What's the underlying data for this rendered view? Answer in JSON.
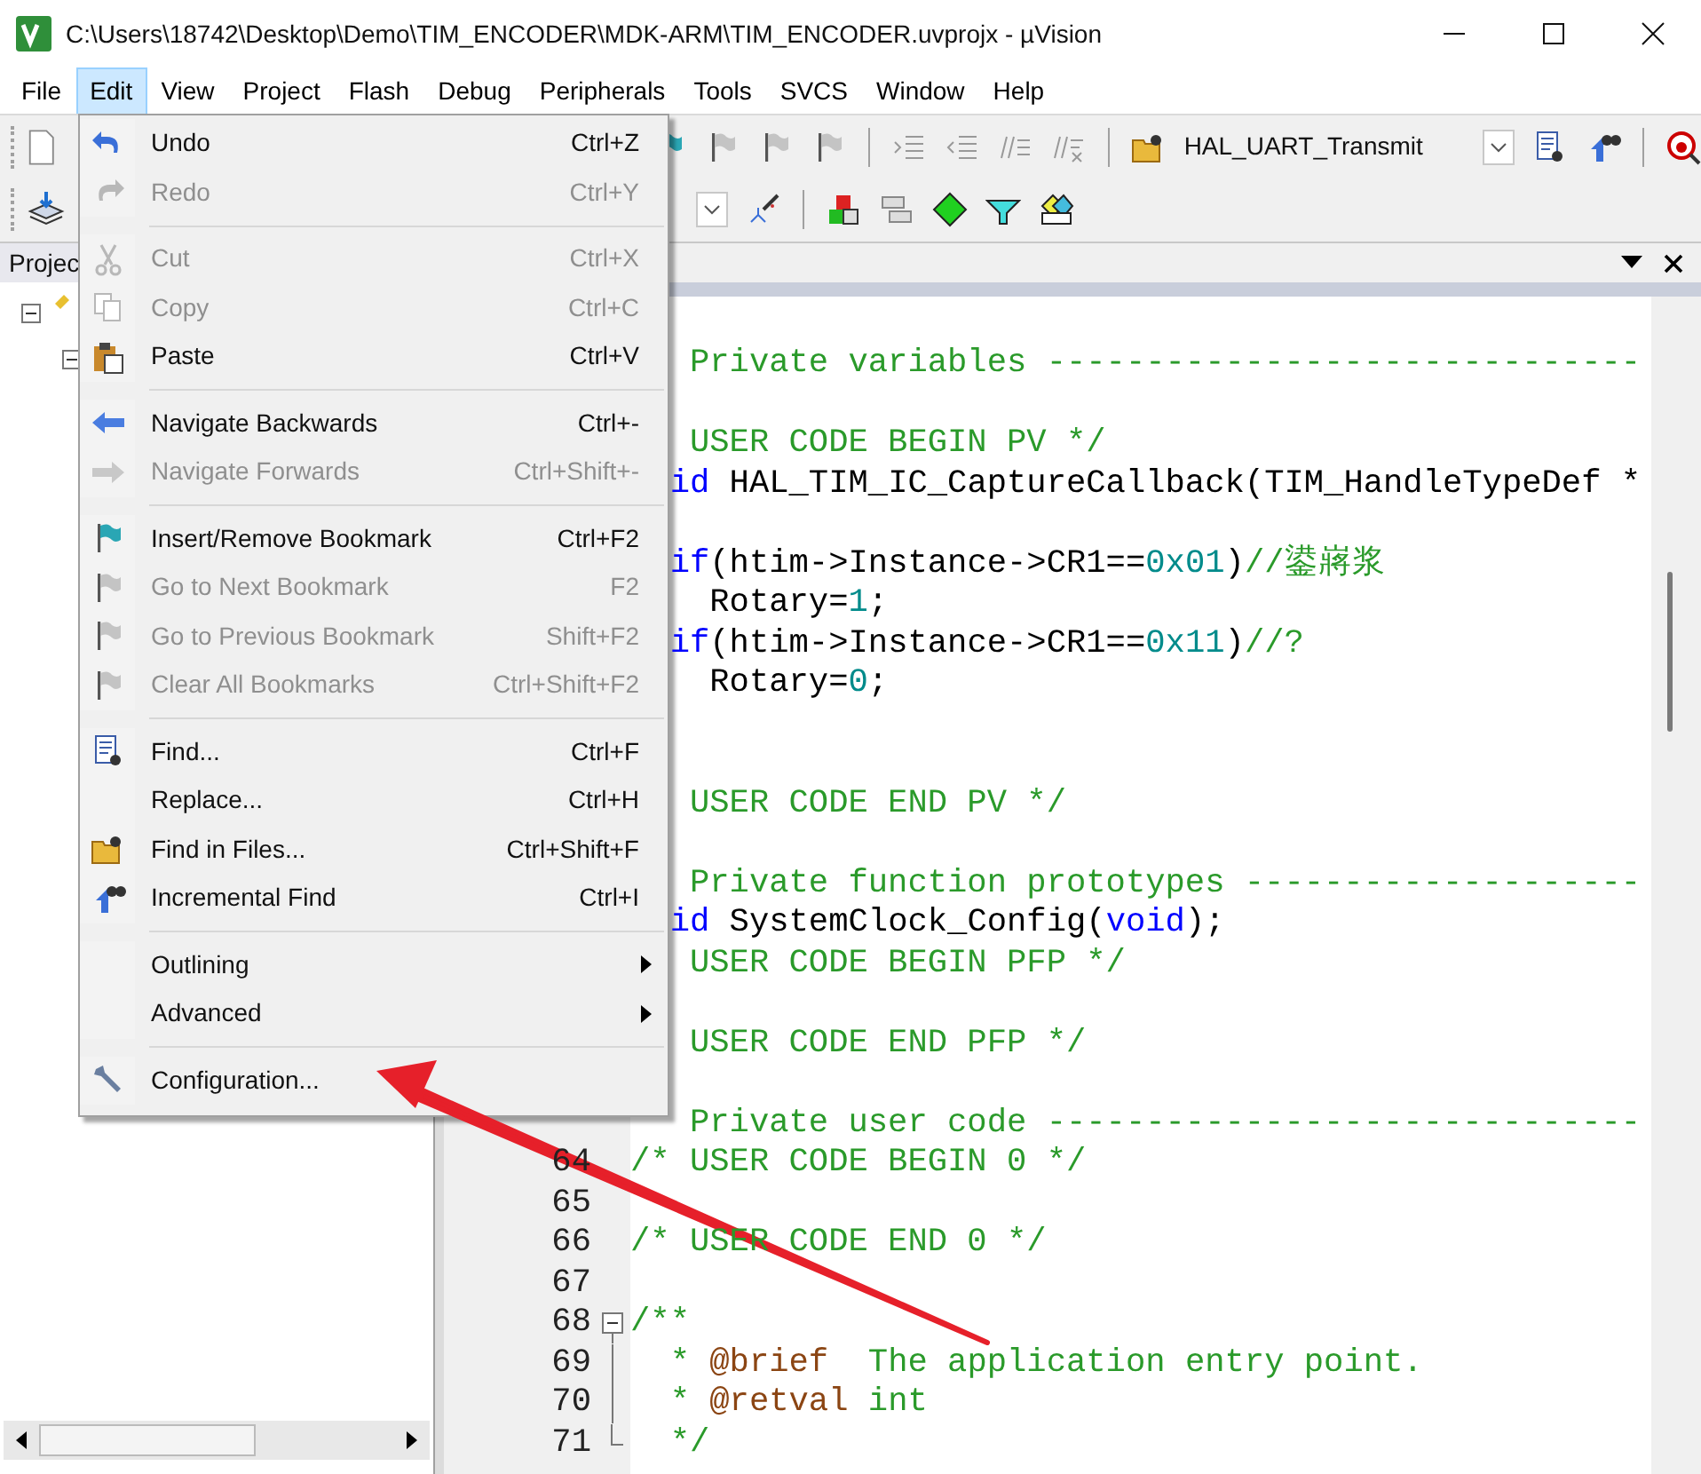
{
  "window": {
    "title": "C:\\Users\\18742\\Desktop\\Demo\\TIM_ENCODER\\MDK-ARM\\TIM_ENCODER.uvprojx - µVision"
  },
  "menubar": [
    {
      "label": "File",
      "selected": false
    },
    {
      "label": "Edit",
      "selected": true
    },
    {
      "label": "View",
      "selected": false
    },
    {
      "label": "Project",
      "selected": false
    },
    {
      "label": "Flash",
      "selected": false
    },
    {
      "label": "Debug",
      "selected": false
    },
    {
      "label": "Peripherals",
      "selected": false
    },
    {
      "label": "Tools",
      "selected": false
    },
    {
      "label": "SVCS",
      "selected": false
    },
    {
      "label": "Window",
      "selected": false
    },
    {
      "label": "Help",
      "selected": false
    }
  ],
  "toolbar": {
    "find_combo": {
      "value": "HAL_UART_Transmit"
    }
  },
  "project_panel": {
    "tab": "Projec"
  },
  "edit_menu": [
    {
      "kind": "item",
      "label": "Undo",
      "shortcut": "Ctrl+Z",
      "disabled": false
    },
    {
      "kind": "item",
      "label": "Redo",
      "shortcut": "Ctrl+Y",
      "disabled": true
    },
    {
      "kind": "separator"
    },
    {
      "kind": "item",
      "label": "Cut",
      "shortcut": "Ctrl+X",
      "disabled": true
    },
    {
      "kind": "item",
      "label": "Copy",
      "shortcut": "Ctrl+C",
      "disabled": true
    },
    {
      "kind": "item",
      "label": "Paste",
      "shortcut": "Ctrl+V",
      "disabled": false
    },
    {
      "kind": "separator"
    },
    {
      "kind": "item",
      "label": "Navigate Backwards",
      "shortcut": "Ctrl+-",
      "disabled": false
    },
    {
      "kind": "item",
      "label": "Navigate Forwards",
      "shortcut": "Ctrl+Shift+-",
      "disabled": true
    },
    {
      "kind": "separator"
    },
    {
      "kind": "item",
      "label": "Insert/Remove Bookmark",
      "shortcut": "Ctrl+F2",
      "disabled": false
    },
    {
      "kind": "item",
      "label": "Go to Next Bookmark",
      "shortcut": "F2",
      "disabled": true
    },
    {
      "kind": "item",
      "label": "Go to Previous Bookmark",
      "shortcut": "Shift+F2",
      "disabled": true
    },
    {
      "kind": "item",
      "label": "Clear All Bookmarks",
      "shortcut": "Ctrl+Shift+F2",
      "disabled": true
    },
    {
      "kind": "separator"
    },
    {
      "kind": "item",
      "label": "Find...",
      "shortcut": "Ctrl+F",
      "disabled": false
    },
    {
      "kind": "item",
      "label": "Replace...",
      "shortcut": "Ctrl+H",
      "disabled": false
    },
    {
      "kind": "item",
      "label": "Find in Files...",
      "shortcut": "Ctrl+Shift+F",
      "disabled": false
    },
    {
      "kind": "item",
      "label": "Incremental Find",
      "shortcut": "Ctrl+I",
      "disabled": false
    },
    {
      "kind": "separator"
    },
    {
      "kind": "submenu",
      "label": "Outlining",
      "disabled": false
    },
    {
      "kind": "submenu",
      "label": "Advanced",
      "disabled": false
    },
    {
      "kind": "separator"
    },
    {
      "kind": "item",
      "label": "Configuration...",
      "disabled": false
    }
  ],
  "editor": {
    "lines": [
      {
        "kind": "code",
        "clipped": true,
        "segments": [
          {
            "kind": "comment",
            "text": " Private variables ------------------------------"
          }
        ]
      },
      {
        "kind": "blank"
      },
      {
        "kind": "code",
        "clipped": true,
        "segments": [
          {
            "kind": "comment",
            "text": " USER CODE BEGIN PV */"
          }
        ]
      },
      {
        "kind": "code",
        "clipped": true,
        "segments": [
          {
            "kind": "keyword",
            "text": "id"
          },
          {
            "kind": "plain",
            "text": " HAL_TIM_IC_CaptureCallback(TIM_HandleTypeDef *"
          }
        ]
      },
      {
        "kind": "blank"
      },
      {
        "kind": "code",
        "clipped": true,
        "segments": [
          {
            "kind": "keyword",
            "text": "if"
          },
          {
            "kind": "plain",
            "text": "(htim->Instance->CR1=="
          },
          {
            "kind": "number",
            "text": "0x01"
          },
          {
            "kind": "plain",
            "text": ")"
          },
          {
            "kind": "comment",
            "text": "//鍙嶈浆"
          }
        ]
      },
      {
        "kind": "code",
        "clipped": true,
        "segments": [
          {
            "kind": "plain",
            "text": "  Rotary="
          },
          {
            "kind": "number",
            "text": "1"
          },
          {
            "kind": "plain",
            "text": ";"
          }
        ]
      },
      {
        "kind": "code",
        "clipped": true,
        "segments": [
          {
            "kind": "keyword",
            "text": "if"
          },
          {
            "kind": "plain",
            "text": "(htim->Instance->CR1=="
          },
          {
            "kind": "number",
            "text": "0x11"
          },
          {
            "kind": "plain",
            "text": ")"
          },
          {
            "kind": "comment",
            "text": "//?"
          }
        ]
      },
      {
        "kind": "code",
        "clipped": true,
        "segments": [
          {
            "kind": "plain",
            "text": "  Rotary="
          },
          {
            "kind": "number",
            "text": "0"
          },
          {
            "kind": "plain",
            "text": ";"
          }
        ]
      },
      {
        "kind": "blank"
      },
      {
        "kind": "blank"
      },
      {
        "kind": "code",
        "clipped": true,
        "segments": [
          {
            "kind": "comment",
            "text": " USER CODE END PV */"
          }
        ]
      },
      {
        "kind": "blank"
      },
      {
        "kind": "code",
        "clipped": true,
        "segments": [
          {
            "kind": "comment",
            "text": " Private function prototypes --------------------"
          }
        ]
      },
      {
        "kind": "code",
        "clipped": true,
        "segments": [
          {
            "kind": "keyword",
            "text": "id"
          },
          {
            "kind": "plain",
            "text": " SystemClock_Config("
          },
          {
            "kind": "keyword",
            "text": "void"
          },
          {
            "kind": "plain",
            "text": ");"
          }
        ]
      },
      {
        "kind": "code",
        "clipped": true,
        "segments": [
          {
            "kind": "comment",
            "text": " USER CODE BEGIN PFP */"
          }
        ]
      },
      {
        "kind": "blank"
      },
      {
        "kind": "code",
        "clipped": true,
        "segments": [
          {
            "kind": "comment",
            "text": " USER CODE END PFP */"
          }
        ]
      },
      {
        "kind": "blank"
      },
      {
        "kind": "code",
        "clipped": true,
        "segments": [
          {
            "kind": "comment",
            "text": " Private user code ------------------------------"
          }
        ]
      },
      {
        "kind": "code",
        "number": "64",
        "segments": [
          {
            "kind": "comment",
            "text": "/* USER CODE BEGIN 0 */"
          }
        ]
      },
      {
        "kind": "code",
        "number": "65"
      },
      {
        "kind": "code",
        "number": "66",
        "segments": [
          {
            "kind": "comment",
            "text": "/* USER CODE END 0 */"
          }
        ]
      },
      {
        "kind": "code",
        "number": "67"
      },
      {
        "kind": "code",
        "number": "68",
        "fold_start": true,
        "segments": [
          {
            "kind": "comment",
            "text": "/**"
          }
        ]
      },
      {
        "kind": "code",
        "number": "69",
        "fold_body": true,
        "segments": [
          {
            "kind": "comment",
            "text": "  * "
          },
          {
            "kind": "tag",
            "text": "@brief"
          },
          {
            "kind": "comment",
            "text": "  The application entry point."
          }
        ]
      },
      {
        "kind": "code",
        "number": "70",
        "fold_body": true,
        "segments": [
          {
            "kind": "comment",
            "text": "  * "
          },
          {
            "kind": "tag",
            "text": "@retval"
          },
          {
            "kind": "comment",
            "text": " int"
          }
        ]
      },
      {
        "kind": "code",
        "number": "71",
        "fold_end": true,
        "segments": [
          {
            "kind": "comment",
            "text": "  */"
          }
        ]
      }
    ]
  }
}
